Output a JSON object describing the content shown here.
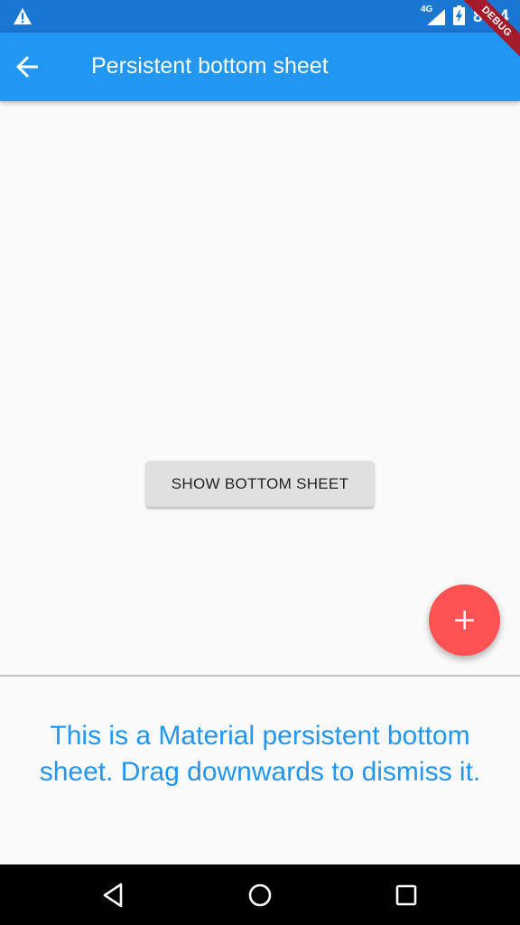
{
  "status_bar": {
    "time": "8:24",
    "network_label": "4G",
    "icons": [
      "warning-icon",
      "signal-icon",
      "battery-charging-icon"
    ]
  },
  "debug_banner": {
    "label": "DEBUG",
    "color": "#a31b2a"
  },
  "app_bar": {
    "title": "Persistent bottom sheet",
    "back_icon": "arrow-back-icon",
    "color": "#2196f3"
  },
  "main": {
    "show_button_label": "SHOW BOTTOM SHEET"
  },
  "fab": {
    "icon": "add-icon",
    "color": "#ff5252"
  },
  "bottom_sheet": {
    "text": "This is a Material persistent bottom sheet. Drag downwards to dismiss it.",
    "text_color": "#2196f3"
  },
  "nav_bar": {
    "buttons": [
      "back-triangle-icon",
      "home-circle-icon",
      "recents-square-icon"
    ]
  }
}
